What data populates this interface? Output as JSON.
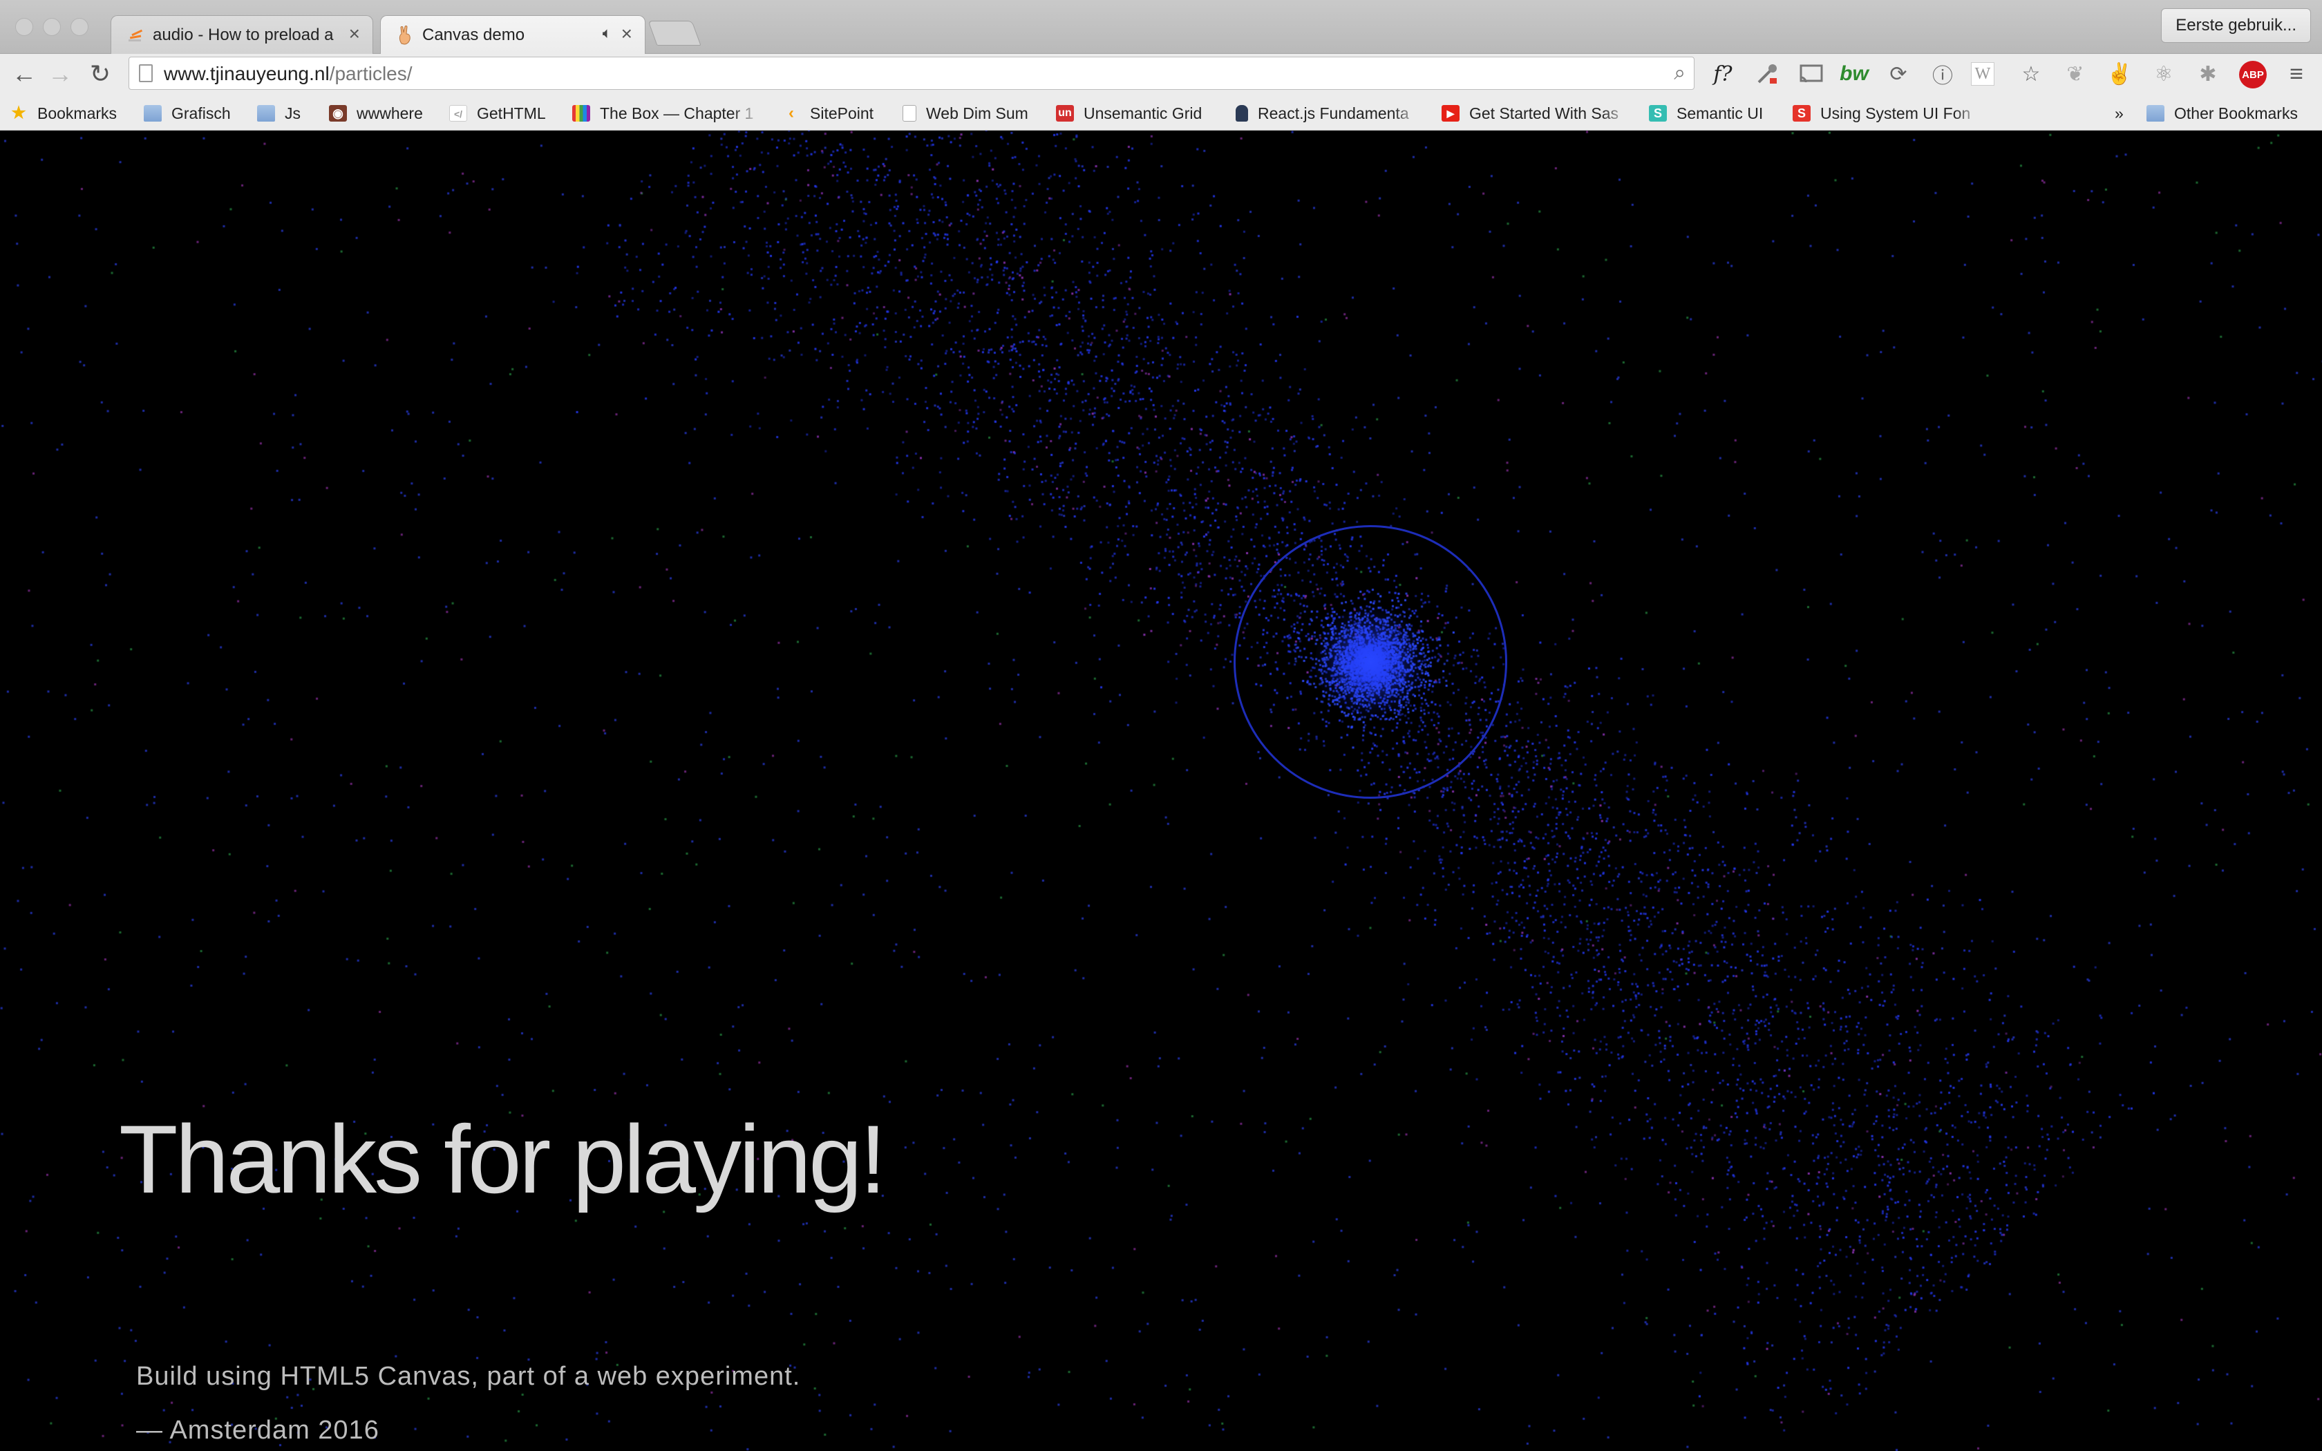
{
  "tabs": [
    {
      "label": "audio - How to preload a so",
      "active": false
    },
    {
      "label": "Canvas demo",
      "active": true
    }
  ],
  "profile_button": "Eerste gebruik...",
  "address_bar": {
    "host": "www.tjinauyeung.nl",
    "path": "/particles/"
  },
  "toolbar_icons": [
    "back-icon",
    "forward-icon",
    "reload-icon",
    "page-icon",
    "zoom-icon",
    "whatfont-icon",
    "color-picker-icon",
    "cast-icon",
    "bw-icon",
    "sync-icon",
    "info-icon",
    "wikipedia-icon",
    "star-icon",
    "feather-icon",
    "peace-hand-icon",
    "react-icon",
    "bug-icon",
    "adblock-icon",
    "menu-icon"
  ],
  "extensions": {
    "whatfont": "f?",
    "bw": "bw",
    "wikipedia": "W",
    "abp": "ABP"
  },
  "bookmarks": [
    "Bookmarks",
    "Grafisch",
    "Js",
    "wwwhere",
    "GetHTML",
    "The Box — Chapter 1",
    "SitePoint",
    "Web Dim Sum",
    "Unsemantic Grid",
    "React.js Fundamenta",
    "Get Started With Sas",
    "Semantic UI",
    "Using System UI Fon"
  ],
  "bookmark_icons": {
    "unsemantic": "un",
    "semantic": "S",
    "gethtml": "</",
    "system_ui": "S"
  },
  "overflow_chevron": "»",
  "other_bookmarks": "Other Bookmarks",
  "page": {
    "headline": "Thanks for playing!",
    "subline": "Build using HTML5 Canvas, part of a web experiment.",
    "signoff": "— Amsterdam 2016"
  },
  "colors": {
    "background": "#000000",
    "particle_blue": "#2a3dff",
    "ring": "#1d2db8",
    "text": "#d9d9d9"
  }
}
